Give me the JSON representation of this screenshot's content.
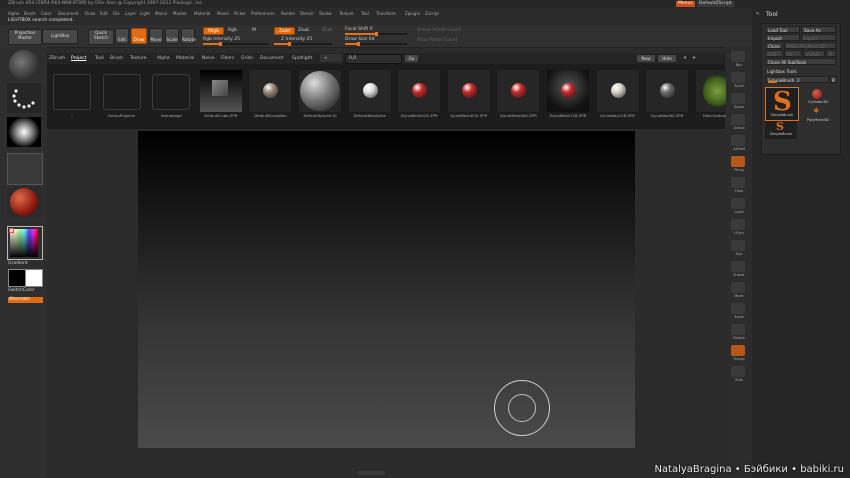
{
  "title": "ZBrush 4R4 [ZBR4-RK4-NNK-KTSM] by Ofer Alon @ Copyright 1997-2012 Pixologic, Inc.",
  "menu_right": {
    "menus_label": "Menus",
    "script_label": "DefaultZScript"
  },
  "menu": [
    "Alpha",
    "Brush",
    "Color",
    "Document",
    "Draw",
    "Edit",
    "File",
    "Layer",
    "Light",
    "Macro",
    "Marker",
    "Material",
    "Movie",
    "Picker",
    "Preferences",
    "Render",
    "Stencil",
    "Stroke",
    "Texture",
    "Tool",
    "Transform",
    "Zplugin",
    "Zscript"
  ],
  "status": "LIGHTBOX search completed.",
  "toolbar": {
    "projection_master": "Projection Master",
    "lightbox": "LightBox",
    "quick_sketch": "Quick Sketch",
    "edit": "Edit",
    "draw": "Draw",
    "move": "Move",
    "scale": "Scale",
    "rotate": "Rotate",
    "mrgb": "Mrgb",
    "rgb": "Rgb",
    "m": "M",
    "rgb_intensity": "Rgb Intensity 25",
    "zadd": "Zadd",
    "zsub": "Zsub",
    "zcut": "Zcut",
    "z_intensity": "Z Intensity 25",
    "focal_shift": "Focal Shift 0",
    "draw_size": "Draw Size 64",
    "active_points": "Active Points Count",
    "total_points": "Total Points Count",
    "focal_shift_value": 0,
    "draw_size_value": 64,
    "rgb_intensity_value": 25,
    "z_intensity_value": 25
  },
  "lightbox": {
    "tabs": [
      "ZBrush",
      "Project",
      "Tool",
      "Brush",
      "Texture",
      "Alpha",
      "Material",
      "Noise",
      "Fibers",
      "Grids",
      "Document",
      "Spotlight"
    ],
    "search_value": "0,0",
    "go_label": "Go",
    "new_label": "New",
    "hide_label": "Hide",
    "items": [
      {
        "label": "..",
        "kind": "folder"
      },
      {
        "label": "DemoProjects",
        "kind": "folder"
      },
      {
        "label": "Homepage",
        "kind": "folder"
      },
      {
        "label": "DefaultCube.ZPR",
        "kind": "cube"
      },
      {
        "label": "DefaultDynaWax",
        "kind": "ball",
        "color": "#9a8a7a"
      },
      {
        "label": "DefaultSphere.ZI",
        "kind": "bigball",
        "color": "#8d8d8d"
      },
      {
        "label": "DefaultWaxSphe",
        "kind": "ball",
        "color": "#e0e0e0"
      },
      {
        "label": "DynaMesh016.ZPR",
        "kind": "ball",
        "color": "#c42a2a"
      },
      {
        "label": "DynaMesh032.ZPR",
        "kind": "ball",
        "color": "#c42a2a"
      },
      {
        "label": "DynaMesh064.ZPR",
        "kind": "ball",
        "color": "#c42a2a"
      },
      {
        "label": "DynaMesh128.ZPR",
        "kind": "ball",
        "color": "#c42a2a"
      },
      {
        "label": "DynaWax128.ZPR",
        "kind": "ball",
        "color": "#d8d2c8"
      },
      {
        "label": "DynaWax64.ZPR",
        "kind": "ball",
        "color": "#6a6a6a"
      },
      {
        "label": "FiberOptions.Z",
        "kind": "fiber"
      }
    ]
  },
  "left_shelf": {
    "gradient_label": "Gradient",
    "switch_color_label": "SwitchColor",
    "alternate_label": "Alternate"
  },
  "right_shelf": {
    "labels": [
      "Bpr",
      "Scroll",
      "Zoom",
      "Actual",
      "AAHalf",
      "Persp",
      "Floor",
      "Local",
      "LSym",
      "Xyz",
      "Frame",
      "Move",
      "Scale",
      "Rotate",
      "Transp",
      "Solo"
    ]
  },
  "tool_panel": {
    "title": "Tool",
    "load_tool": "Load Tool",
    "save_as": "Save As",
    "import": "Import",
    "export": "Export",
    "clone": "Clone",
    "make_polymesh": "Make PolyMesh3D",
    "goz": "GoZ",
    "all": "All",
    "visible": "Visible",
    "r": "R",
    "clone_all_subtools": "Clone All SubTools",
    "lightbox_tools": "Lightbox Tools",
    "current_tool": "SimpleBrush. 2",
    "current_tool_r": "R",
    "tools": [
      {
        "label": "SimpleBrush",
        "color": "#e27b1a"
      },
      {
        "label": "Cylinder3D",
        "color": "#c42a2a"
      },
      {
        "label": "PolyMesh3D",
        "color": "#e27b1a"
      },
      {
        "label": "SimpleBrush",
        "color": "#e27b1a"
      }
    ]
  },
  "watermark": "NatalyaBragina • Бэйбики • babiki.ru",
  "colors": {
    "accent": "#e26a10",
    "menus_button": "#d24b14"
  }
}
